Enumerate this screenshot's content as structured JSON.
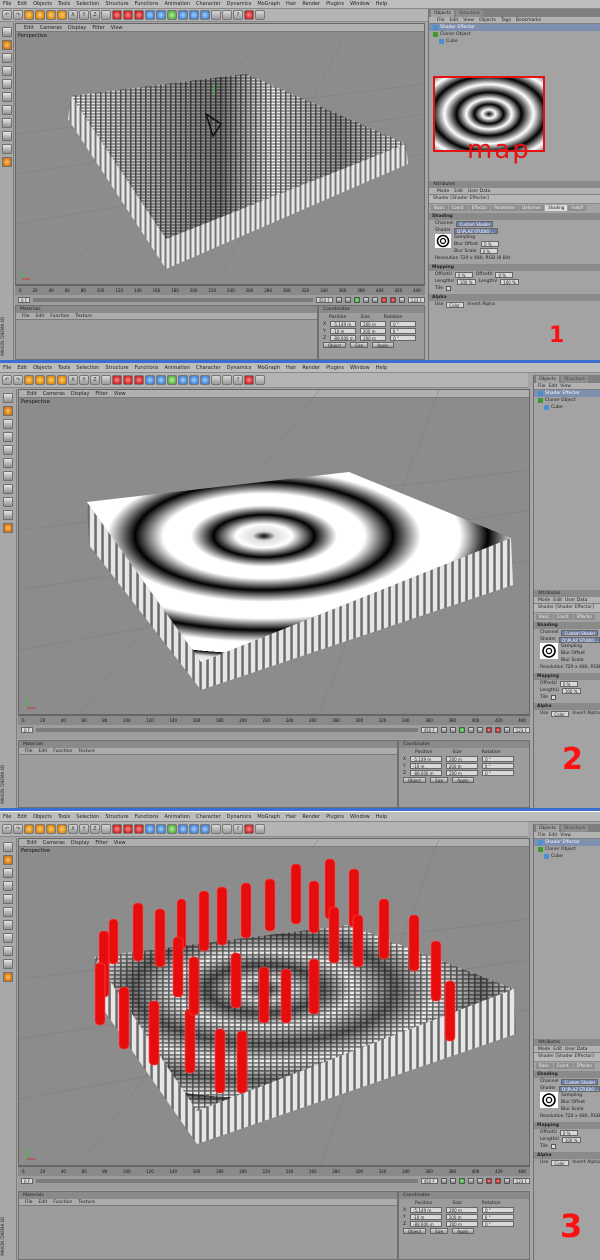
{
  "menu": [
    "File",
    "Edit",
    "Objects",
    "Tools",
    "Selection",
    "Structure",
    "Functions",
    "Animation",
    "Character",
    "Dynamics",
    "MoGraph",
    "Hair",
    "Render",
    "Plugins",
    "Window",
    "Help"
  ],
  "viewport": {
    "menu": [
      "Edit",
      "Cameras",
      "Display",
      "Filter",
      "View"
    ],
    "label": "Perspective"
  },
  "timeline": {
    "ticks": [
      "0",
      "20",
      "40",
      "60",
      "80",
      "100",
      "120",
      "140",
      "160",
      "180",
      "200",
      "220",
      "240",
      "260",
      "280",
      "300",
      "320",
      "340",
      "360",
      "380",
      "400",
      "420",
      "440"
    ],
    "start": "0 F",
    "end": "450 F",
    "current": "123 F"
  },
  "materials": {
    "title": "Materials",
    "menu": [
      "File",
      "Edit",
      "Function",
      "Texture"
    ]
  },
  "coordinates": {
    "title": "Coordinates",
    "heads": [
      "Position",
      "Size",
      "Rotation"
    ],
    "rows": [
      {
        "axis": "X",
        "pos": "-5.149 m",
        "size": "200 m",
        "rot_label": "H",
        "rot": "0 °"
      },
      {
        "axis": "Y",
        "pos": "-10 m",
        "size": "200 m",
        "rot_label": "P",
        "rot": "0 °"
      },
      {
        "axis": "Z",
        "pos": "-88.606 m",
        "size": "200 m",
        "rot_label": "B",
        "rot": "0 °"
      }
    ],
    "mode": "Object",
    "size_mode": "Size",
    "apply": "Apply"
  },
  "objects": {
    "tabs": [
      "Objects",
      "Structure"
    ],
    "menu": [
      "File",
      "Edit",
      "View",
      "Objects",
      "Tags",
      "Bookmarks"
    ],
    "items": [
      "Shader Effector",
      "Cloner Object",
      "Cube"
    ]
  },
  "attributes": {
    "header": "Attributes",
    "menu": [
      "Mode",
      "Edit",
      "User Data"
    ],
    "title": "Shader [Shader Effector]",
    "tabs": [
      "Basic",
      "Coord.",
      "Effector",
      "Parameter",
      "Deformer",
      "Shading",
      "Falloff"
    ],
    "shading_label": "Shading",
    "channel_label": "Channel",
    "channel_value": "Custom Shader",
    "shader_label": "Shader",
    "shader_value": "D:\\PLAZ STUDIO ...",
    "sampling": "Sampling",
    "blur_offset": "Blur Offset",
    "blur_offset_val": "0 %",
    "blur_scale": "Blur Scale",
    "blur_scale_val": "0 %",
    "resolution": "Resolution 720 x 480, RGB (8 Bit)",
    "mapping": "Mapping",
    "offset_u": "OffsetU",
    "offset_u_val": "0 %",
    "offset_v": "OffsetV",
    "offset_v_val": "0 %",
    "length_u": "LengthU",
    "length_u_val": "100 %",
    "length_v": "LengthV",
    "length_v_val": "100 %",
    "tile": "Tile",
    "alpha": "Alpha",
    "use": "Use",
    "use_val": "Color",
    "invert_alpha": "Invert Alpha"
  },
  "annotations": {
    "map": "map",
    "n1": "1",
    "n2": "2",
    "n3": "3"
  },
  "brand": "MAXON CINEMA 4D",
  "colors": {
    "annotation_red": "#e41212",
    "frame_blue": "#3a6fd0",
    "selection": "#7e8fb0"
  }
}
